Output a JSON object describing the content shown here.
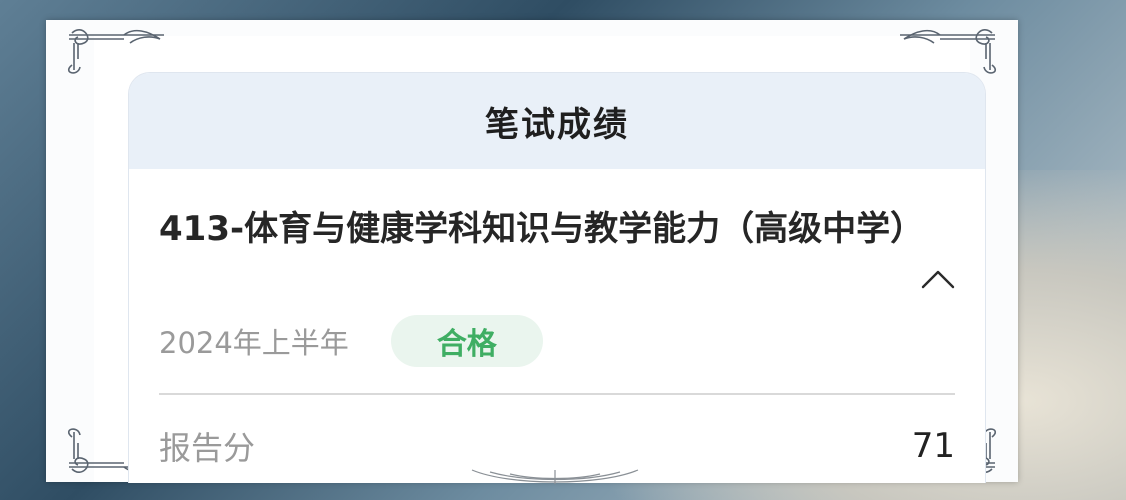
{
  "card": {
    "title": "笔试成绩",
    "subject": "413-体育与健康学科知识与教学能力（高级中学）",
    "period": "2024年上半年",
    "status": "合格",
    "score_label": "报告分",
    "score_value": "71"
  },
  "colors": {
    "header_bg": "#e9f0f8",
    "badge_bg": "#eaf5ee",
    "badge_text": "#3fae63",
    "muted_text": "#9a9a9a"
  },
  "icons": {
    "collapse": "chevron-up-icon"
  }
}
